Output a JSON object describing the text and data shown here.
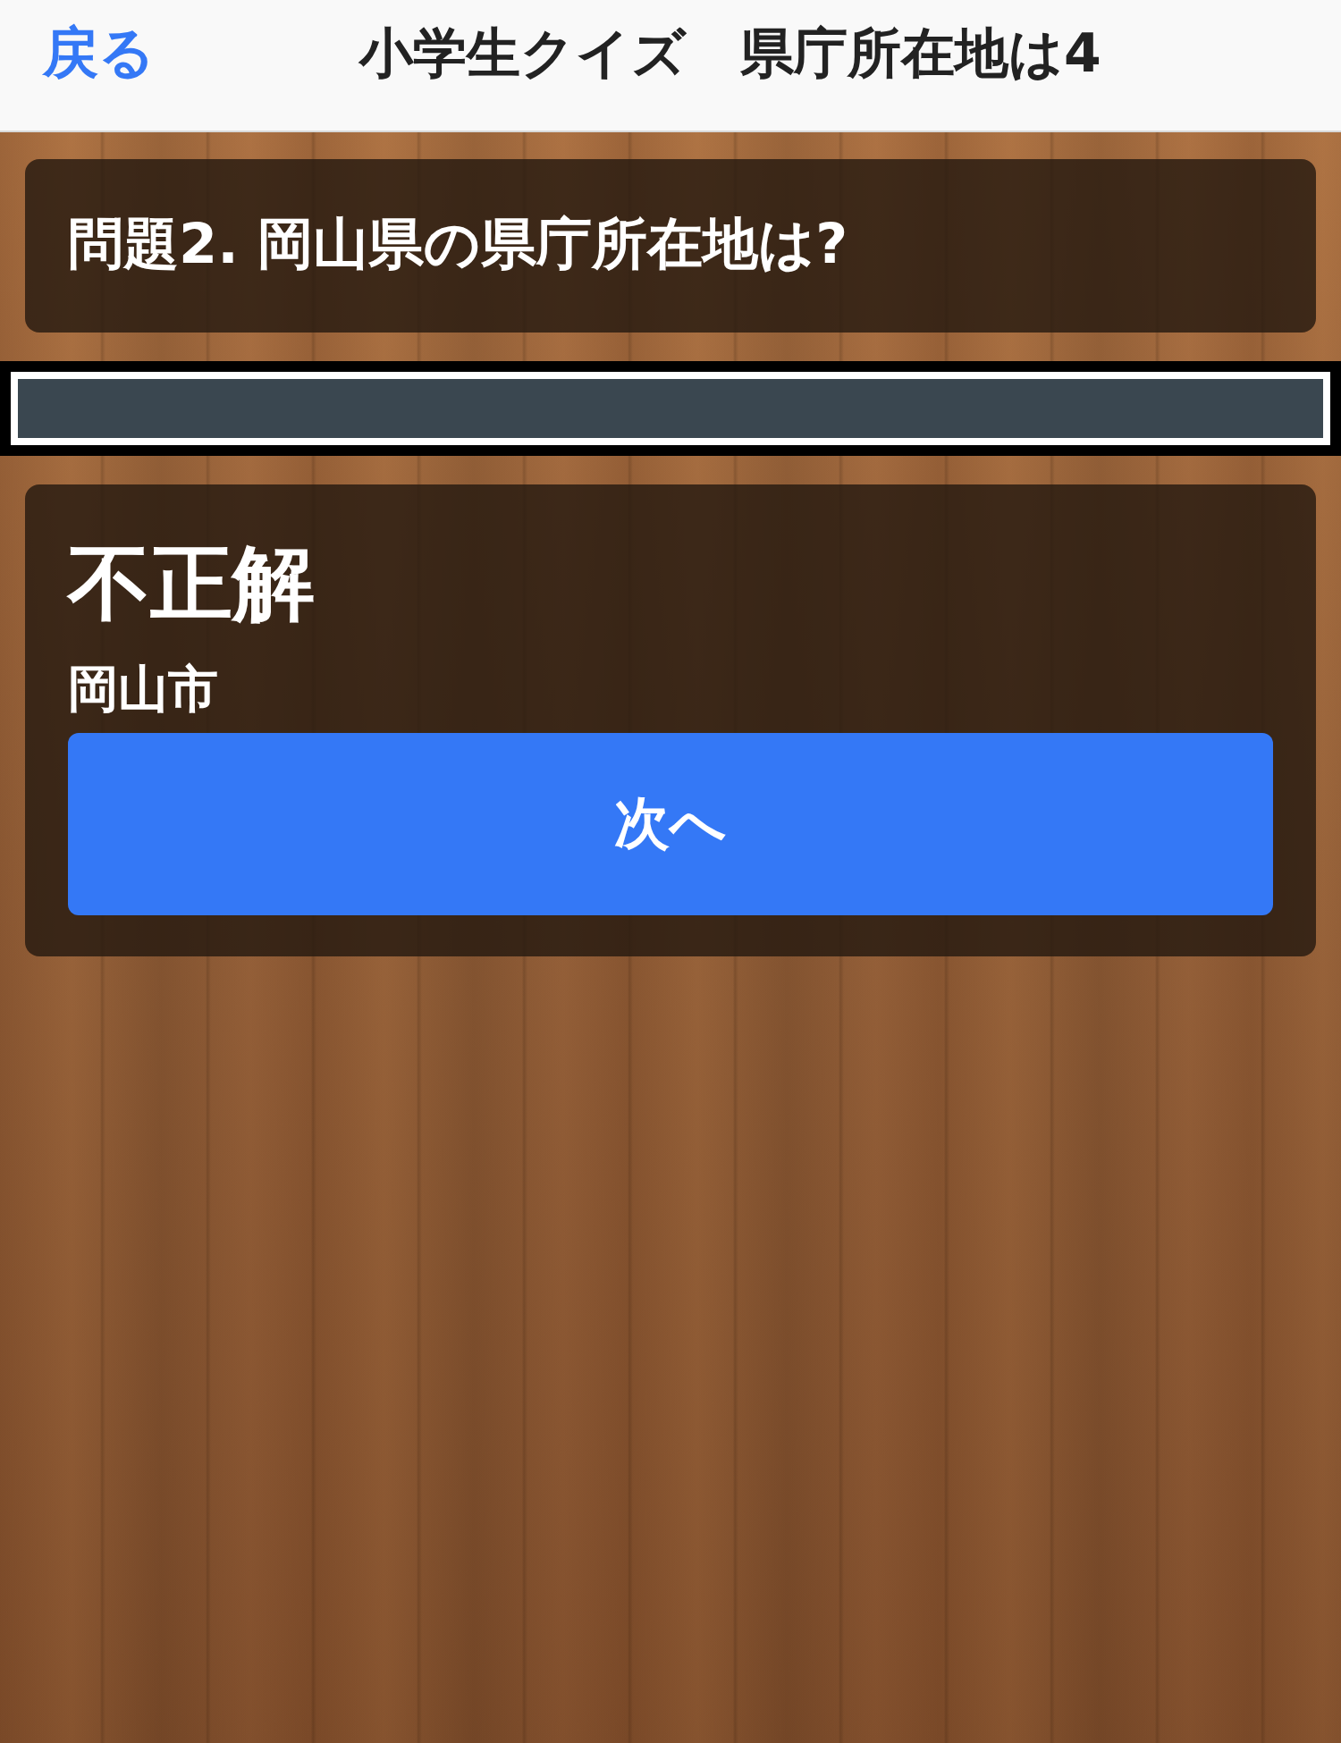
{
  "nav": {
    "back": "戻る",
    "title": "小学生クイズ　県庁所在地は4"
  },
  "question": {
    "text": "問題2. 岡山県の県庁所在地は?"
  },
  "result": {
    "verdict": "不正解",
    "answer": "岡山市",
    "button": "次へ"
  }
}
